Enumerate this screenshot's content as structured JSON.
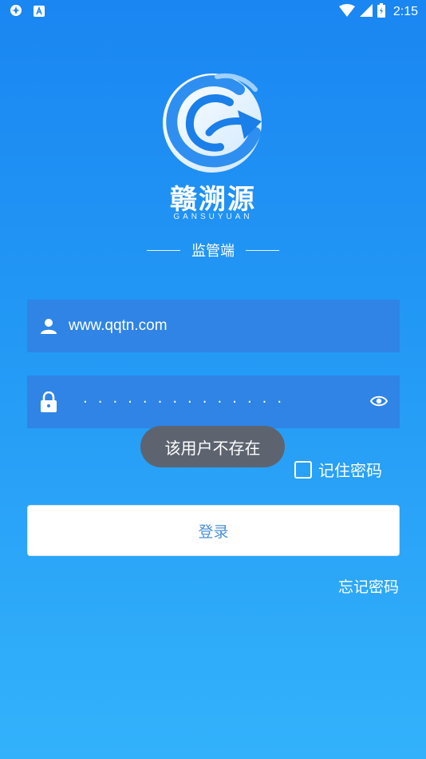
{
  "status_bar": {
    "time": "2:15",
    "left_icons": [
      "sync-icon",
      "app-a-icon"
    ],
    "right_icons": [
      "wifi-icon",
      "signal-icon",
      "battery-icon"
    ]
  },
  "brand": {
    "name": "赣溯源",
    "pinyin": "GANSUYUAN",
    "subtitle": "监管端",
    "logo_icon": "gansuyuan-logo"
  },
  "form": {
    "username_value": "www.qqtn.com",
    "username_icon": "user-icon",
    "password_mask": "··············",
    "password_icon": "lock-icon",
    "reveal_icon": "eye-icon",
    "remember_label": "记住密码",
    "remember_checked": false,
    "login_label": "登录",
    "forgot_label": "忘记密码"
  },
  "toast": {
    "message": "该用户不存在"
  },
  "colors": {
    "bg_top": "#1a86f2",
    "bg_bottom": "#33b2fb",
    "field_bg": "#2f84e6",
    "toast_bg": "#5d6470",
    "login_text": "#4a90d9"
  }
}
